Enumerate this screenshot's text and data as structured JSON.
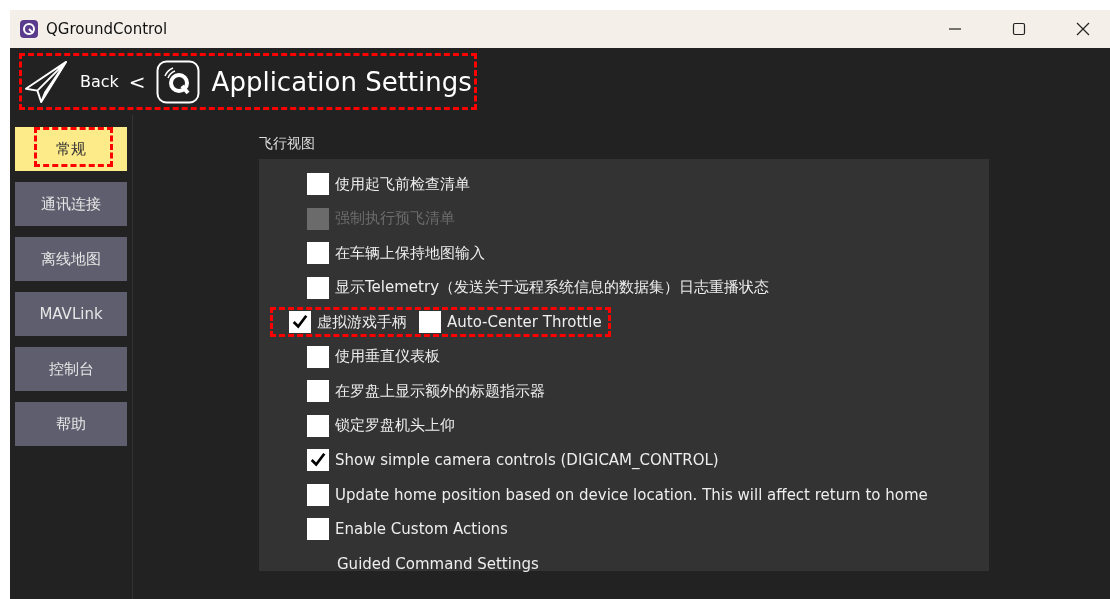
{
  "window": {
    "title": "QGroundControl"
  },
  "header": {
    "back": "Back",
    "separator": "<",
    "title": "Application Settings",
    "annotated": true
  },
  "sidebar": {
    "items": [
      {
        "label": "常规",
        "selected": true,
        "annotated": true
      },
      {
        "label": "通讯连接",
        "selected": false,
        "annotated": false
      },
      {
        "label": "离线地图",
        "selected": false,
        "annotated": false
      },
      {
        "label": "MAVLink",
        "selected": false,
        "annotated": false
      },
      {
        "label": "控制台",
        "selected": false,
        "annotated": false
      },
      {
        "label": "帮助",
        "selected": false,
        "annotated": false
      }
    ]
  },
  "section": {
    "title": "飞行视图",
    "rows": [
      {
        "kind": "check",
        "label": "使用起飞前检查清单",
        "checked": false,
        "disabled": false
      },
      {
        "kind": "check",
        "label": "强制执行预飞清单",
        "checked": false,
        "disabled": true
      },
      {
        "kind": "check",
        "label": "在车辆上保持地图输入",
        "checked": false,
        "disabled": false
      },
      {
        "kind": "check",
        "label": "显示Telemetry（发送关于远程系统信息的数据集）日志重播状态",
        "checked": false,
        "disabled": false
      },
      {
        "kind": "pair",
        "annotated": true,
        "items": [
          {
            "label": "虚拟游戏手柄",
            "checked": true
          },
          {
            "label": "Auto-Center Throttle",
            "checked": false
          }
        ]
      },
      {
        "kind": "check",
        "label": "使用垂直仪表板",
        "checked": false,
        "disabled": false
      },
      {
        "kind": "check",
        "label": "在罗盘上显示额外的标题指示器",
        "checked": false,
        "disabled": false
      },
      {
        "kind": "check",
        "label": "锁定罗盘机头上仰",
        "checked": false,
        "disabled": false
      },
      {
        "kind": "check",
        "label": "Show simple camera controls (DIGICAM_CONTROL)",
        "checked": true,
        "disabled": false
      },
      {
        "kind": "check",
        "label": "Update home position based on device location. This will affect return to home",
        "checked": false,
        "disabled": false
      },
      {
        "kind": "check",
        "label": "Enable Custom Actions",
        "checked": false,
        "disabled": false
      },
      {
        "kind": "label",
        "label": "Guided Command Settings"
      }
    ]
  }
}
